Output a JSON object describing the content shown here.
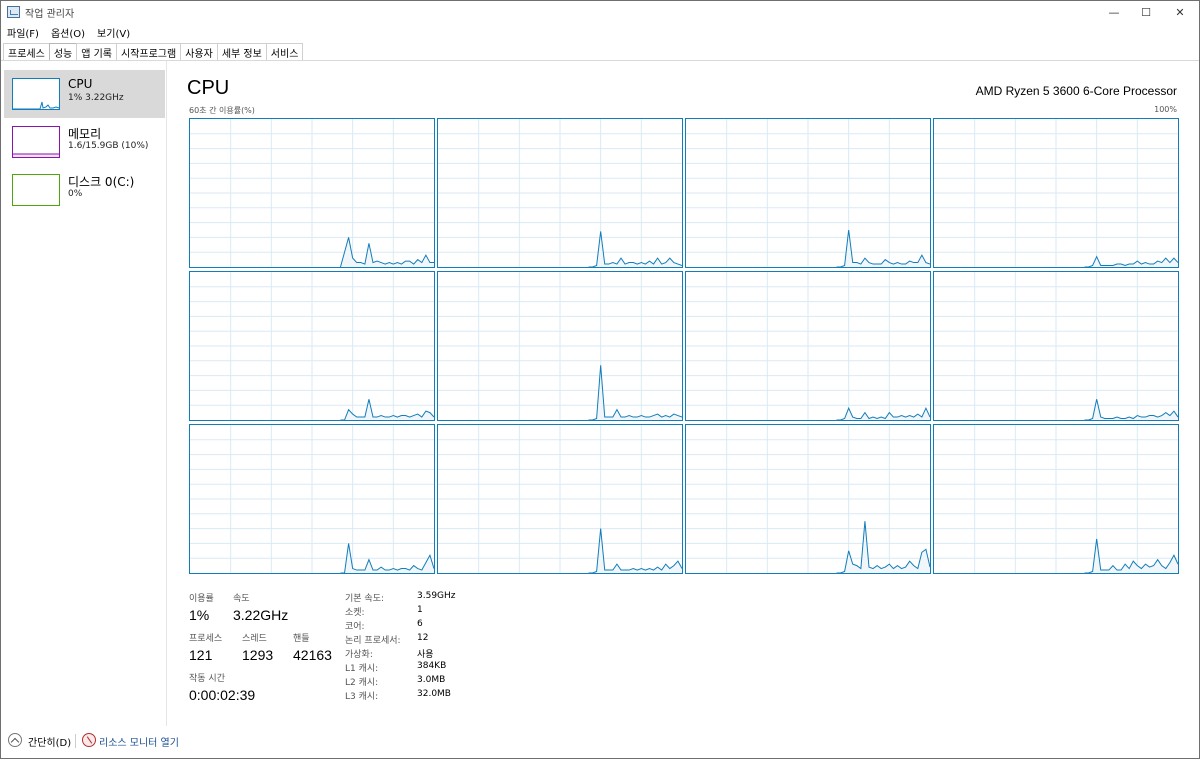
{
  "window": {
    "title": "작업 관리자",
    "minimize": "—",
    "maximize": "☐",
    "close": "✕"
  },
  "menu": [
    "파일(F)",
    "옵션(O)",
    "보기(V)"
  ],
  "tabs": [
    "프로세스",
    "성능",
    "앱 기록",
    "시작프로그램",
    "사용자",
    "세부 정보",
    "서비스"
  ],
  "active_tab": "성능",
  "sidebar": [
    {
      "title": "CPU",
      "sub": "1% 3.22GHz",
      "color": "#117dbb"
    },
    {
      "title": "메모리",
      "sub": "1.6/15.9GB (10%)",
      "color": "#8b12ae"
    },
    {
      "title": "디스크 0(C:)",
      "sub": "0%",
      "color": "#4da60c"
    }
  ],
  "main": {
    "title": "CPU",
    "model": "AMD Ryzen 5 3600 6-Core Processor",
    "graph_label": "60초 간 이용률(%)",
    "graph_max": "100%"
  },
  "chart_data": {
    "type": "line",
    "ylim": [
      0,
      100
    ],
    "xlim": [
      0,
      60
    ],
    "series": [
      {
        "x": [
          37,
          38,
          39,
          40,
          41,
          42,
          43,
          44,
          45,
          46,
          47,
          48,
          49,
          50,
          51,
          52,
          53,
          54,
          55,
          56,
          57,
          58,
          59,
          60
        ],
        "values": [
          0,
          10,
          20,
          6,
          3,
          3,
          2,
          16,
          3,
          4,
          3,
          2,
          3,
          2,
          3,
          2,
          4,
          4,
          2,
          5,
          3,
          8,
          3,
          3
        ]
      },
      {
        "x": [
          37,
          38,
          39,
          40,
          41,
          42,
          43,
          44,
          45,
          46,
          47,
          48,
          49,
          50,
          51,
          52,
          53,
          54,
          55,
          56,
          57,
          58,
          59,
          60
        ],
        "values": [
          0,
          0,
          1,
          24,
          2,
          2,
          3,
          2,
          6,
          2,
          3,
          3,
          2,
          3,
          2,
          4,
          2,
          6,
          2,
          3,
          6,
          3,
          2,
          1
        ]
      },
      {
        "x": [
          37,
          38,
          39,
          40,
          41,
          42,
          43,
          44,
          45,
          46,
          47,
          48,
          49,
          50,
          51,
          52,
          53,
          54,
          55,
          56,
          57,
          58,
          59,
          60
        ],
        "values": [
          0,
          0,
          1,
          25,
          3,
          3,
          2,
          6,
          3,
          2,
          2,
          2,
          5,
          3,
          2,
          3,
          2,
          2,
          4,
          3,
          3,
          8,
          3,
          2
        ]
      },
      {
        "x": [
          37,
          38,
          39,
          40,
          41,
          42,
          43,
          44,
          45,
          46,
          47,
          48,
          49,
          50,
          51,
          52,
          53,
          54,
          55,
          56,
          57,
          58,
          59,
          60
        ],
        "values": [
          0,
          0,
          1,
          7,
          1,
          1,
          1,
          1,
          2,
          2,
          1,
          2,
          2,
          4,
          2,
          3,
          2,
          2,
          4,
          3,
          6,
          3,
          6,
          3
        ]
      },
      {
        "x": [
          37,
          38,
          39,
          40,
          41,
          42,
          43,
          44,
          45,
          46,
          47,
          48,
          49,
          50,
          51,
          52,
          53,
          54,
          55,
          56,
          57,
          58,
          59,
          60
        ],
        "values": [
          0,
          0,
          7,
          4,
          2,
          2,
          2,
          14,
          2,
          2,
          3,
          2,
          2,
          3,
          2,
          3,
          3,
          2,
          3,
          4,
          2,
          6,
          5,
          2
        ]
      },
      {
        "x": [
          37,
          38,
          39,
          40,
          41,
          42,
          43,
          44,
          45,
          46,
          47,
          48,
          49,
          50,
          51,
          52,
          53,
          54,
          55,
          56,
          57,
          58,
          59,
          60
        ],
        "values": [
          0,
          0,
          1,
          37,
          2,
          2,
          2,
          7,
          2,
          2,
          3,
          2,
          2,
          3,
          2,
          2,
          3,
          4,
          2,
          3,
          2,
          4,
          3,
          2
        ]
      },
      {
        "x": [
          37,
          38,
          39,
          40,
          41,
          42,
          43,
          44,
          45,
          46,
          47,
          48,
          49,
          50,
          51,
          52,
          53,
          54,
          55,
          56,
          57,
          58,
          59,
          60
        ],
        "values": [
          0,
          0,
          1,
          8,
          2,
          1,
          1,
          5,
          1,
          2,
          1,
          2,
          1,
          5,
          2,
          2,
          3,
          2,
          3,
          2,
          4,
          2,
          8,
          2
        ]
      },
      {
        "x": [
          37,
          38,
          39,
          40,
          41,
          42,
          43,
          44,
          45,
          46,
          47,
          48,
          49,
          50,
          51,
          52,
          53,
          54,
          55,
          56,
          57,
          58,
          59,
          60
        ],
        "values": [
          0,
          0,
          1,
          14,
          2,
          1,
          1,
          1,
          2,
          1,
          1,
          2,
          1,
          3,
          2,
          2,
          3,
          3,
          2,
          3,
          5,
          3,
          6,
          2
        ]
      },
      {
        "x": [
          37,
          38,
          39,
          40,
          41,
          42,
          43,
          44,
          45,
          46,
          47,
          48,
          49,
          50,
          51,
          52,
          53,
          54,
          55,
          56,
          57,
          58,
          59,
          60
        ],
        "values": [
          0,
          0,
          20,
          3,
          2,
          2,
          2,
          9,
          2,
          2,
          4,
          2,
          2,
          3,
          2,
          3,
          3,
          2,
          5,
          3,
          2,
          7,
          12,
          3
        ]
      },
      {
        "x": [
          37,
          38,
          39,
          40,
          41,
          42,
          43,
          44,
          45,
          46,
          47,
          48,
          49,
          50,
          51,
          52,
          53,
          54,
          55,
          56,
          57,
          58,
          59,
          60
        ],
        "values": [
          0,
          0,
          1,
          30,
          2,
          2,
          2,
          6,
          2,
          2,
          2,
          3,
          2,
          3,
          2,
          3,
          2,
          4,
          2,
          6,
          3,
          5,
          8,
          3
        ]
      },
      {
        "x": [
          37,
          38,
          39,
          40,
          41,
          42,
          43,
          44,
          45,
          46,
          47,
          48,
          49,
          50,
          51,
          52,
          53,
          54,
          55,
          56,
          57,
          58,
          59,
          60
        ],
        "values": [
          0,
          0,
          1,
          15,
          6,
          5,
          3,
          35,
          4,
          3,
          5,
          3,
          4,
          6,
          3,
          5,
          3,
          4,
          8,
          5,
          3,
          14,
          16,
          4
        ]
      },
      {
        "x": [
          37,
          38,
          39,
          40,
          41,
          42,
          43,
          44,
          45,
          46,
          47,
          48,
          49,
          50,
          51,
          52,
          53,
          54,
          55,
          56,
          57,
          58,
          59,
          60
        ],
        "values": [
          0,
          0,
          1,
          23,
          2,
          2,
          2,
          5,
          2,
          2,
          6,
          3,
          8,
          5,
          3,
          6,
          4,
          5,
          9,
          5,
          3,
          7,
          12,
          6
        ]
      }
    ]
  },
  "stats": {
    "usage_label": "이용률",
    "usage": "1%",
    "speed_label": "속도",
    "speed": "3.22GHz",
    "proc_label": "프로세스",
    "proc": "121",
    "thread_label": "스레드",
    "thread": "1293",
    "handle_label": "핸들",
    "handle": "42163",
    "uptime_label": "작동 시간",
    "uptime": "0:00:02:39"
  },
  "details": [
    {
      "label": "기본 속도:",
      "value": "3.59GHz"
    },
    {
      "label": "소켓:",
      "value": "1"
    },
    {
      "label": "코어:",
      "value": "6"
    },
    {
      "label": "논리 프로세서:",
      "value": "12"
    },
    {
      "label": "가상화:",
      "value": "사용"
    },
    {
      "label": "L1 캐시:",
      "value": "384KB"
    },
    {
      "label": "L2 캐시:",
      "value": "3.0MB"
    },
    {
      "label": "L3 캐시:",
      "value": "32.0MB"
    }
  ],
  "bottom": {
    "fewer": "간단히(D)",
    "resmon": "리소스 모니터 열기"
  }
}
